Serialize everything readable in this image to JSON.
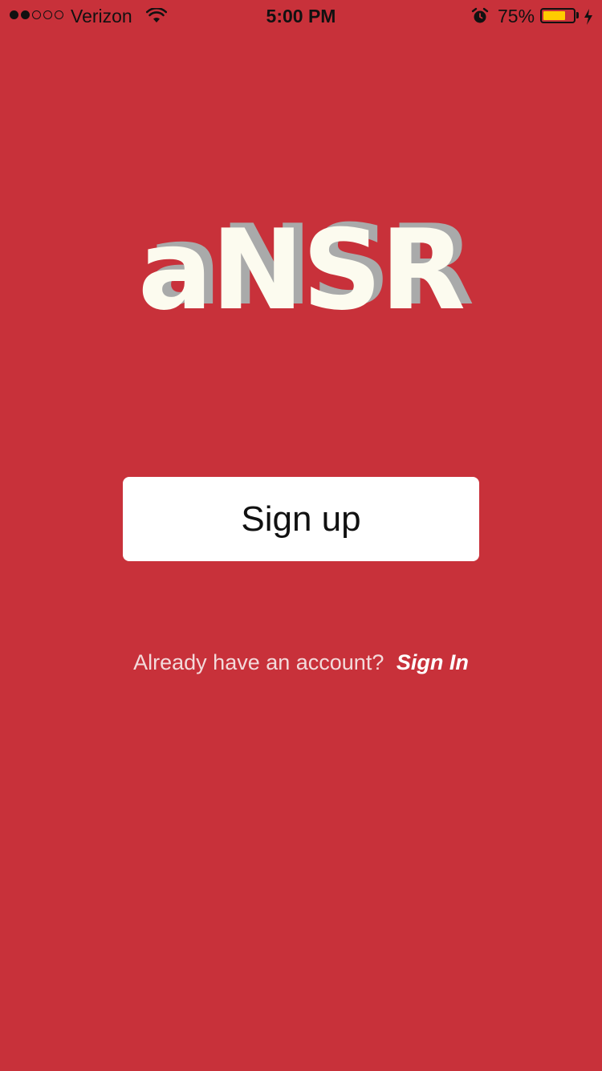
{
  "status_bar": {
    "carrier": "Verizon",
    "signal_bars": 2,
    "signal_total": 5,
    "time": "5:00 PM",
    "battery_percent": "75%",
    "battery_level": 0.75,
    "icons": [
      "signal-icon",
      "wifi-icon",
      "alarm-icon",
      "battery-icon",
      "charging-bolt-icon"
    ]
  },
  "logo": {
    "text": "aNSR"
  },
  "signup": {
    "label": "Sign up"
  },
  "signin": {
    "prompt": "Already have an account?",
    "link_label": "Sign In"
  },
  "colors": {
    "background": "#C8313A",
    "logo_fill": "#FCFBEF",
    "logo_shadow": "#A9AAAA",
    "button_bg": "#FFFFFF",
    "battery_fill": "#FFCC00"
  }
}
